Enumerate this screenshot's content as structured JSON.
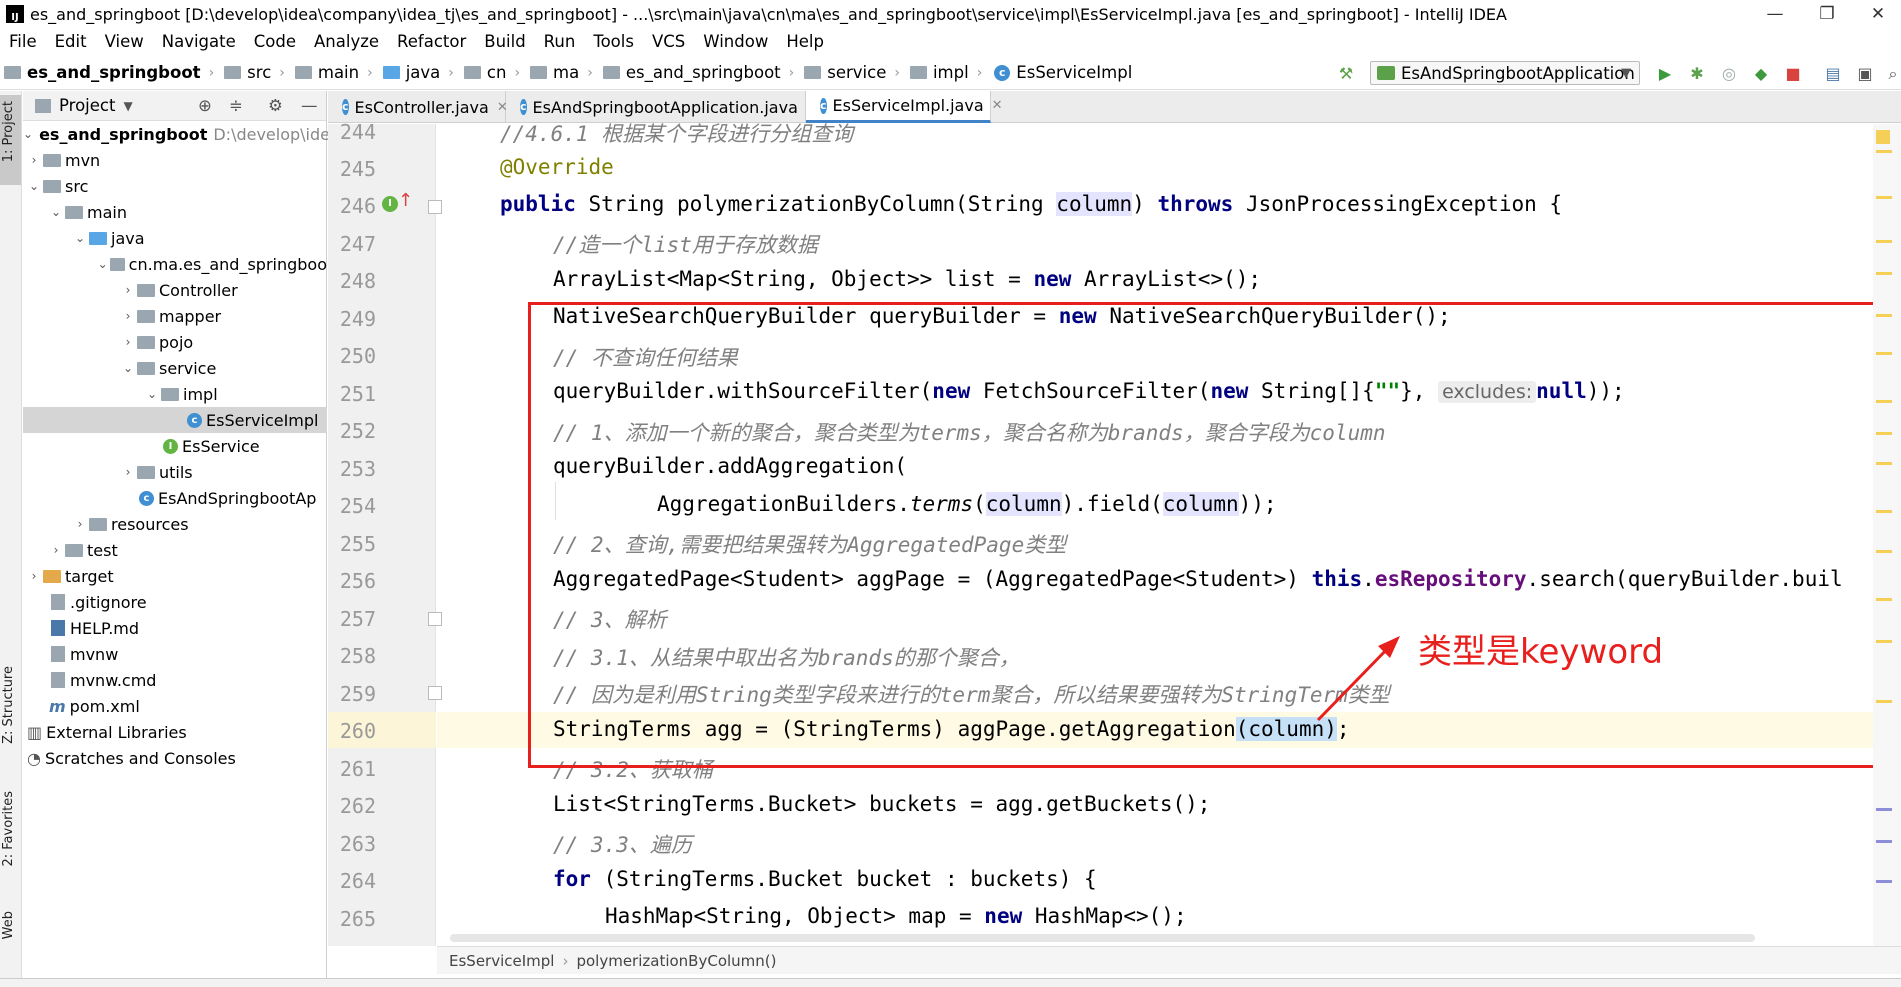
{
  "window": {
    "title": "es_and_springboot [D:\\develop\\idea\\company\\idea_tj\\es_and_springboot] - ...\\src\\main\\java\\cn\\ma\\es_and_springboot\\service\\impl\\EsServiceImpl.java [es_and_springboot] - IntelliJ IDEA",
    "minimize": "—",
    "maximize": "❐",
    "close": "✕"
  },
  "menu": [
    "File",
    "Edit",
    "View",
    "Navigate",
    "Code",
    "Analyze",
    "Refactor",
    "Build",
    "Run",
    "Tools",
    "VCS",
    "Window",
    "Help"
  ],
  "breadcrumbs": [
    "es_and_springboot",
    "src",
    "main",
    "java",
    "cn",
    "ma",
    "es_and_springboot",
    "service",
    "impl",
    "EsServiceImpl"
  ],
  "run_config": "EsAndSpringbootApplication",
  "project_panel": {
    "title": "Project",
    "root": "es_and_springboot",
    "root_path": "D:\\develop\\idea\\c",
    "items": [
      {
        "label": "mvn"
      },
      {
        "label": "src"
      },
      {
        "label": "main"
      },
      {
        "label": "java"
      },
      {
        "label": "cn.ma.es_and_springboo"
      },
      {
        "label": "Controller"
      },
      {
        "label": "mapper"
      },
      {
        "label": "pojo"
      },
      {
        "label": "service"
      },
      {
        "label": "impl"
      },
      {
        "label": "EsServiceImpl"
      },
      {
        "label": "EsService"
      },
      {
        "label": "utils"
      },
      {
        "label": "EsAndSpringbootAp"
      },
      {
        "label": "resources"
      },
      {
        "label": "test"
      },
      {
        "label": "target"
      },
      {
        "label": ".gitignore"
      },
      {
        "label": "HELP.md"
      },
      {
        "label": "mvnw"
      },
      {
        "label": "mvnw.cmd"
      },
      {
        "label": "pom.xml"
      },
      {
        "label": "External Libraries"
      },
      {
        "label": "Scratches and Consoles"
      }
    ]
  },
  "left_strip": {
    "project": "1: Project",
    "structure": "Z: Structure",
    "favorites": "2: Favorites",
    "web": "Web"
  },
  "tabs": [
    {
      "label": "EsController.java"
    },
    {
      "label": "EsAndSpringbootApplication.java"
    },
    {
      "label": "EsServiceImpl.java"
    }
  ],
  "editor": {
    "line_numbers": [
      "244",
      "245",
      "246",
      "247",
      "248",
      "249",
      "250",
      "251",
      "252",
      "253",
      "254",
      "255",
      "256",
      "257",
      "258",
      "259",
      "260",
      "261",
      "262",
      "263",
      "264",
      "265"
    ],
    "lines": {
      "l244": "//4.6.1 根据某个字段进行分组查询",
      "l245": "@Override",
      "l246_a": "public",
      "l246_b": " String polymerizationByColumn(String ",
      "l246_c": "column",
      "l246_d": ") ",
      "l246_e": "throws",
      "l246_f": " JsonProcessingException {",
      "l247": "//造一个list用于存放数据",
      "l248_a": "ArrayList<Map<String, Object>> list = ",
      "l248_b": "new",
      "l248_c": " ArrayList<>();",
      "l249_a": "NativeSearchQueryBuilder queryBuilder = ",
      "l249_b": "new",
      "l249_c": " NativeSearchQueryBuilder();",
      "l250": "// 不查询任何结果",
      "l251_a": "queryBuilder.withSourceFilter(",
      "l251_b": "new",
      "l251_c": " FetchSourceFilter(",
      "l251_d": "new",
      "l251_e": " String[]{",
      "l251_f": "\"\"",
      "l251_g": "}, ",
      "l251_hint": "excludes:",
      "l251_h": "null",
      "l251_i": "));",
      "l252": "// 1、添加一个新的聚合，聚合类型为terms，聚合名称为brands，聚合字段为column",
      "l253": "queryBuilder.addAggregation(",
      "l254_a": "AggregationBuilders.",
      "l254_b": "terms",
      "l254_c": "(",
      "l254_d": "column",
      "l254_e": ").field(",
      "l254_f": "column",
      "l254_g": "));",
      "l255": "// 2、查询,需要把结果强转为AggregatedPage类型",
      "l256_a": "AggregatedPage<Student> aggPage = (AggregatedPage<Student>) ",
      "l256_b": "this",
      "l256_c": ".",
      "l256_d": "esRepository",
      "l256_e": ".search(queryBuilder.buil",
      "l257": "// 3、解析",
      "l258": "// 3.1、从结果中取出名为brands的那个聚合，",
      "l259": "// 因为是利用String类型字段来进行的term聚合，所以结果要强转为StringTerm类型",
      "l260_a": "StringTerms agg = (StringTerms) aggPage.getAggregation",
      "l260_b": "(column)",
      "l260_c": ";",
      "l261": "// 3.2、获取桶",
      "l262": "List<StringTerms.Bucket> buckets = agg.getBuckets();",
      "l263": "// 3.3、遍历",
      "l264_a": "for",
      "l264_b": " (StringTerms.Bucket bucket : buckets) {",
      "l265_a": "HashMap<String, Object> map = ",
      "l265_b": "new",
      "l265_c": " HashMap<>();"
    }
  },
  "annotation": {
    "text": "类型是keyword",
    "color": "#e8201d"
  },
  "editor_breadcrumb": [
    "EsServiceImpl",
    "polymerizationByColumn()"
  ]
}
